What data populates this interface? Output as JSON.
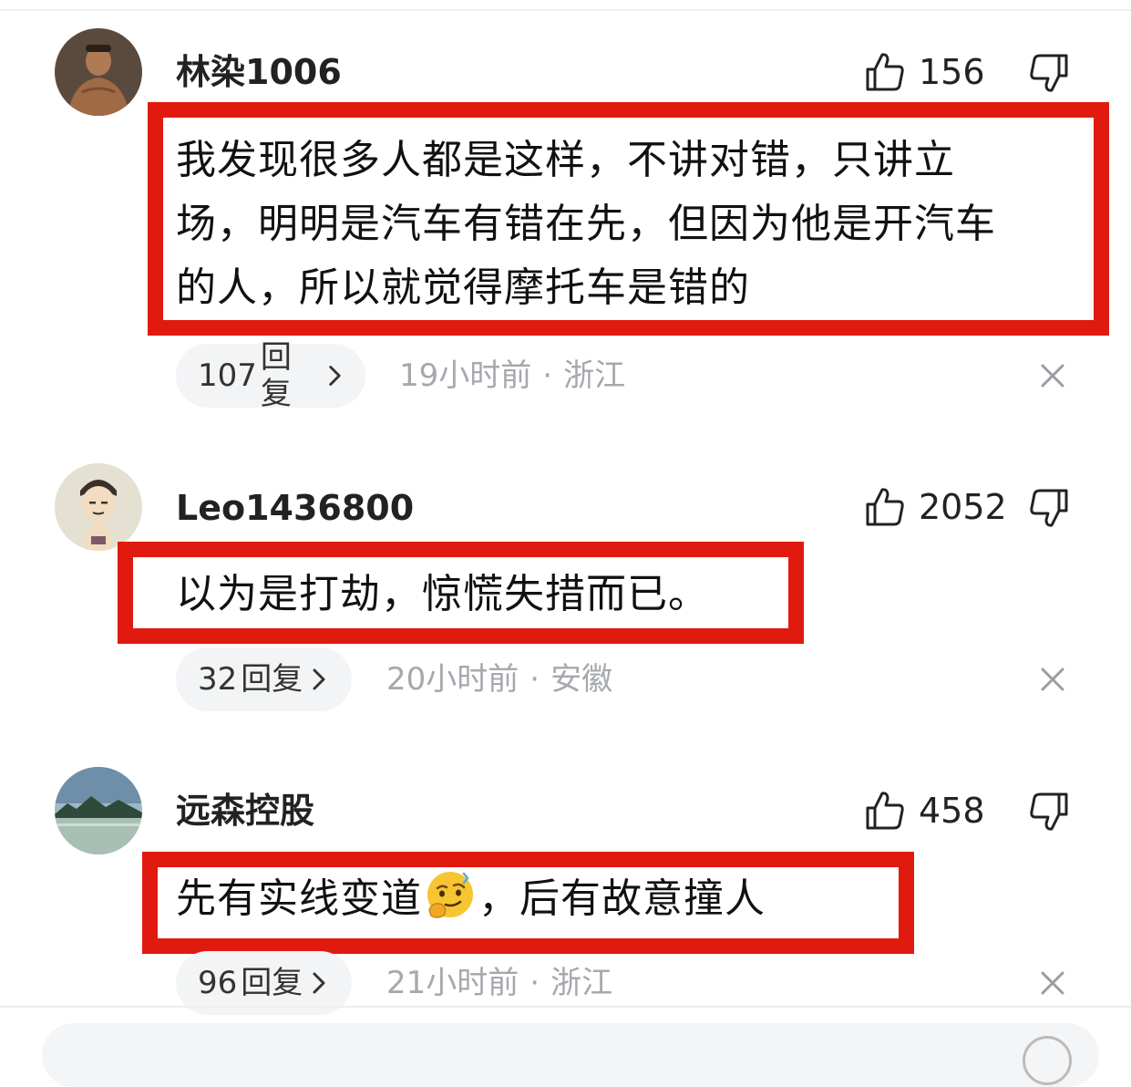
{
  "comments": [
    {
      "username": "林染1006",
      "likes": "156",
      "text_lines": [
        "我发现很多人都是这样，不讲对错，只讲立",
        "场，明明是汽车有错在先，但因为他是开汽车",
        "的人，所以就觉得摩托车是错的"
      ],
      "reply_count": "107",
      "reply_label": "回复",
      "time": "19小时前",
      "location": "浙江"
    },
    {
      "username": "Leo1436800",
      "likes": "2052",
      "text_lines": [
        "以为是打劫，惊慌失措而已。"
      ],
      "reply_count": "32",
      "reply_label": "回复",
      "time": "20小时前",
      "location": "安徽"
    },
    {
      "username": "远森控股",
      "likes": "458",
      "text_before_emoji": "先有实线变道",
      "emoji": "thinking-smirk-emoji",
      "text_after_emoji": "，后有故意撞人",
      "reply_count": "96",
      "reply_label": "回复",
      "time": "21小时前",
      "location": "浙江"
    }
  ],
  "meta_separator": "·",
  "colors": {
    "highlight_box": "#e01a0f",
    "meta_text": "#a5a8ad",
    "reply_pill_bg": "#f3f4f5"
  }
}
